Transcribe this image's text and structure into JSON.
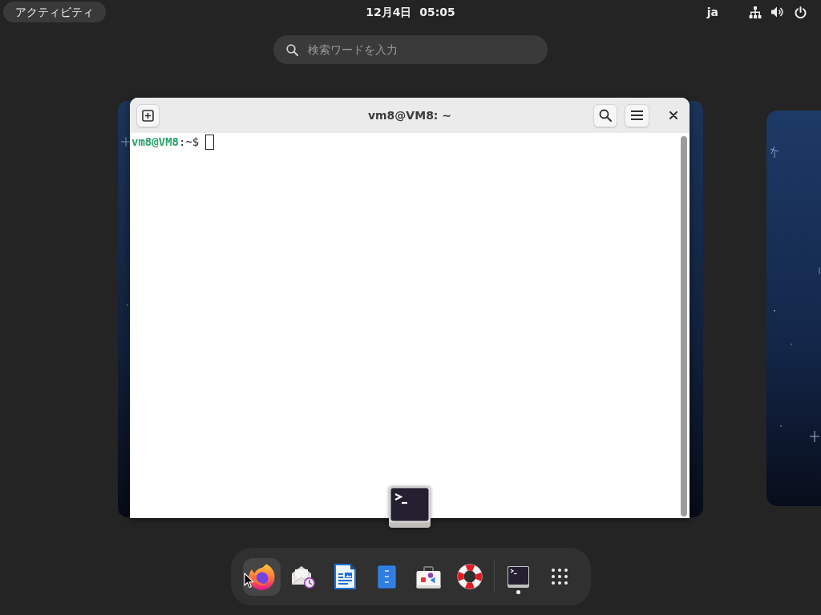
{
  "top_bar": {
    "activities": "アクティビティ",
    "clock": "12月4日  05:05",
    "input_source": "ja"
  },
  "search": {
    "placeholder": "検索ワードを入力"
  },
  "terminal_window": {
    "title": "vm8@VM8: ~",
    "prompt": {
      "user_host": "vm8@VM8",
      "path": ":~$"
    }
  },
  "dock": {
    "favorites": [
      {
        "kind": "browser",
        "running": false,
        "hovered": true
      },
      {
        "kind": "mail",
        "running": false,
        "hovered": false
      },
      {
        "kind": "document",
        "running": false,
        "hovered": false
      },
      {
        "kind": "notes",
        "running": false,
        "hovered": false
      },
      {
        "kind": "software",
        "running": false,
        "hovered": false
      },
      {
        "kind": "help",
        "running": false,
        "hovered": false
      }
    ],
    "other_running": [
      {
        "kind": "terminal",
        "running": true,
        "hovered": false
      }
    ]
  }
}
